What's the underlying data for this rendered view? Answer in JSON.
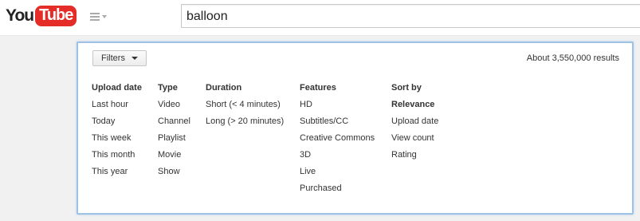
{
  "header": {
    "logo_you": "You",
    "logo_tube": "Tube",
    "search_value": "balloon"
  },
  "filters": {
    "button_label": "Filters",
    "results": "About 3,550,000 results",
    "columns": [
      {
        "heading": "Upload date",
        "items": [
          "Last hour",
          "Today",
          "This week",
          "This month",
          "This year"
        ]
      },
      {
        "heading": "Type",
        "items": [
          "Video",
          "Channel",
          "Playlist",
          "Movie",
          "Show"
        ]
      },
      {
        "heading": "Duration",
        "items": [
          "Short (< 4 minutes)",
          "Long (> 20 minutes)"
        ]
      },
      {
        "heading": "Features",
        "items": [
          "HD",
          "Subtitles/CC",
          "Creative Commons",
          "3D",
          "Live",
          "Purchased"
        ]
      },
      {
        "heading": "Sort by",
        "items": [
          "Relevance",
          "Upload date",
          "View count",
          "Rating"
        ]
      }
    ]
  },
  "colors": {
    "brand_red": "#e52d27",
    "panel_border": "#9ec2e6"
  }
}
